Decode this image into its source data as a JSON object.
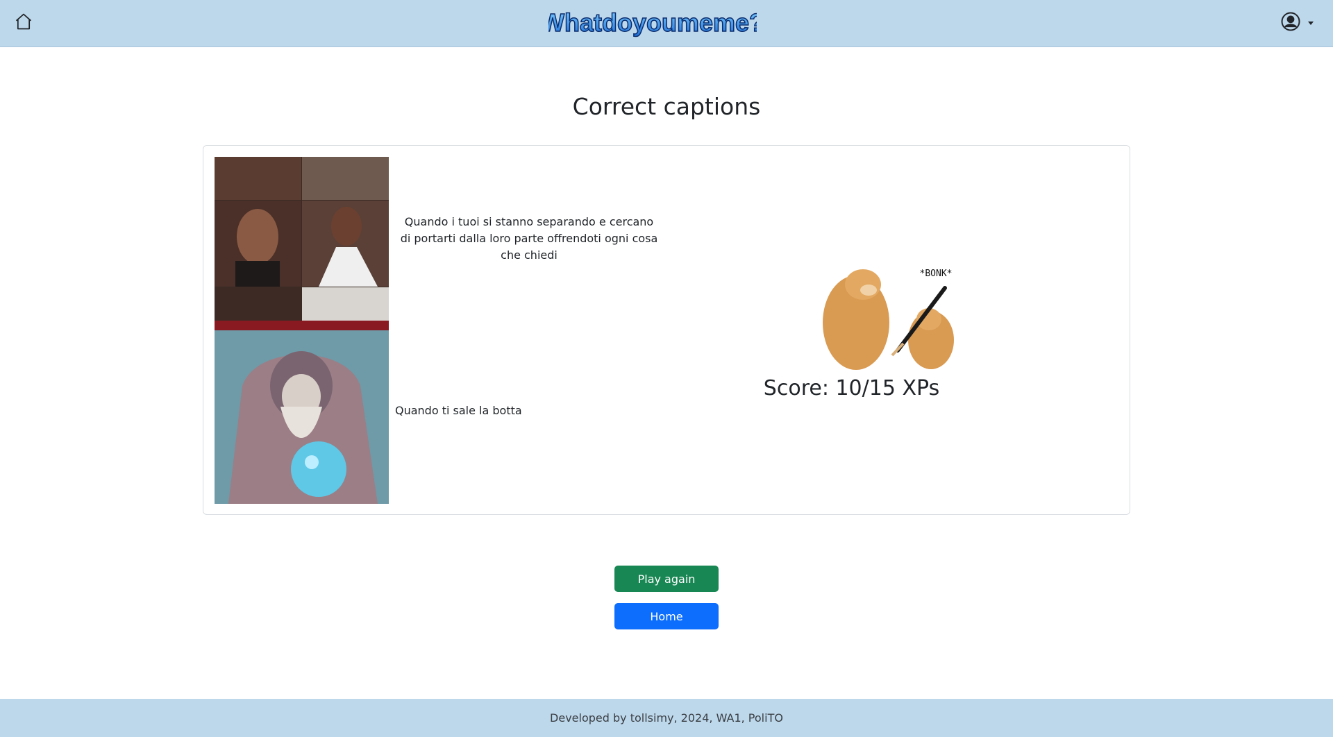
{
  "header": {
    "logo_text": "Whatdoyoumeme?",
    "home_icon": "home-icon",
    "user_icon": "user-circle-icon"
  },
  "page": {
    "title": "Correct captions"
  },
  "results": {
    "items": [
      {
        "caption": "Quando i tuoi si stanno separando e cercano di portarti dalla loro parte offrendoti ogni cosa che chiedi"
      },
      {
        "caption": "Quando ti sale la botta"
      }
    ],
    "bonk_label": "*BONK*",
    "score": "Score: 10/15 XPs"
  },
  "actions": {
    "play_again": "Play again",
    "home": "Home"
  },
  "footer": {
    "text": "Developed by tollsimy, 2024, WA1, PoliTO"
  },
  "colors": {
    "navbar_bg": "#bdd7eb",
    "play_again": "#198754",
    "home": "#0d6efd"
  }
}
